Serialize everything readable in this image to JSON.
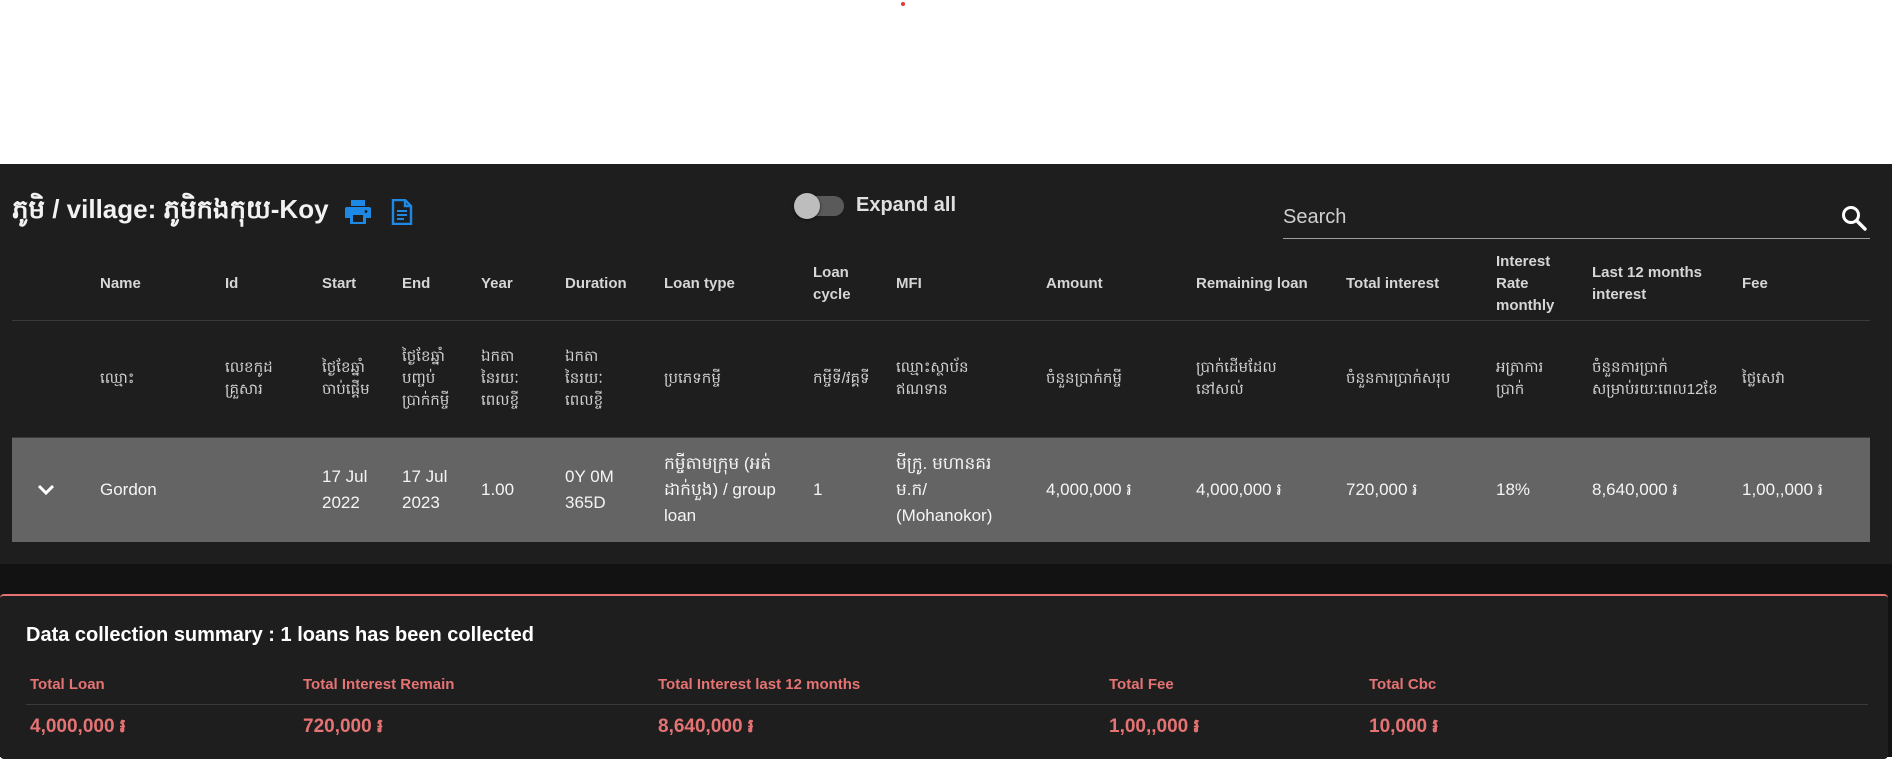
{
  "page": {
    "title": "ភូមិ / village: ភូមិកងកុយ-Koy",
    "expand_all_label": "Expand all",
    "search_placeholder": "Search"
  },
  "table": {
    "headers": [
      {
        "en": "Name",
        "kh": "ឈ្មោះ"
      },
      {
        "en": "Id",
        "kh": "លេខកូដគ្រួសារ"
      },
      {
        "en": "Start",
        "kh": "ថ្ងៃខែឆ្នាំចាប់ផ្តើម"
      },
      {
        "en": "End",
        "kh": "ថ្ងៃខែឆ្នាំបញ្ចប់ប្រាក់កម្ចី"
      },
      {
        "en": "Year",
        "kh": "ឯកតានៃរយៈពេលខ្ចី"
      },
      {
        "en": "Duration",
        "kh": "ឯកតានៃរយៈពេលខ្ចី"
      },
      {
        "en": "Loan type",
        "kh": "ប្រភេទកម្ចី"
      },
      {
        "en": "Loan cycle",
        "kh": "កម្ចីទី/វគ្គទី"
      },
      {
        "en": "MFI",
        "kh": "ឈ្មោះស្ថាប័នឥណទាន"
      },
      {
        "en": "Amount",
        "kh": "ចំនួនប្រាក់កម្ចី"
      },
      {
        "en": "Remaining loan",
        "kh": "ប្រាក់ដើមដែលនៅសល់"
      },
      {
        "en": "Total interest",
        "kh": "ចំនួនការប្រាក់សរុប"
      },
      {
        "en": "Interest Rate monthly",
        "kh": "អត្រាការប្រាក់"
      },
      {
        "en": "Last 12 months interest",
        "kh": "ចំនួនការប្រាក់សម្រាប់រយៈពេល12ខែ"
      },
      {
        "en": "Fee",
        "kh": "ថ្លៃសេវា"
      }
    ],
    "rows": [
      {
        "name": "Gordon",
        "id": "",
        "start": "17 Jul 2022",
        "end": "17 Jul 2023",
        "year": "1.00",
        "duration": "0Y 0M 365D",
        "loan_type": "កម្ចីតាមក្រុម (អត់ដាក់បួង) / group loan",
        "loan_cycle": "1",
        "mfi": "មីក្រូ. មហានគរ ម.ក/ (Mohanokor)",
        "amount": "4,000,000 ៛",
        "remaining_loan": "4,000,000 ៛",
        "total_interest": "720,000 ៛",
        "interest_rate": "18%",
        "last_12_months": "8,640,000 ៛",
        "fee": "1,00,,000 ៛"
      }
    ]
  },
  "summary": {
    "title": "Data collection summary : 1 loans has been collected",
    "items": [
      {
        "label": "Total Loan",
        "value": "4,000,000 ៛"
      },
      {
        "label": "Total Interest Remain",
        "value": "720,000 ៛"
      },
      {
        "label": "Total Interest last 12 months",
        "value": "8,640,000 ៛"
      },
      {
        "label": "Total Fee",
        "value": "1,00,,000 ៛"
      },
      {
        "label": "Total Cbc",
        "value": "10,000 ៛"
      }
    ]
  },
  "colors": {
    "accent_blue": "#1e88e5",
    "summary_accent": "#e57373",
    "row_highlight": "#646464",
    "panel_bg": "#1e1e1e"
  },
  "icons": [
    "print-icon",
    "document-icon",
    "search-icon",
    "chevron-down-icon",
    "scroll-left-icon",
    "scroll-right-icon"
  ]
}
